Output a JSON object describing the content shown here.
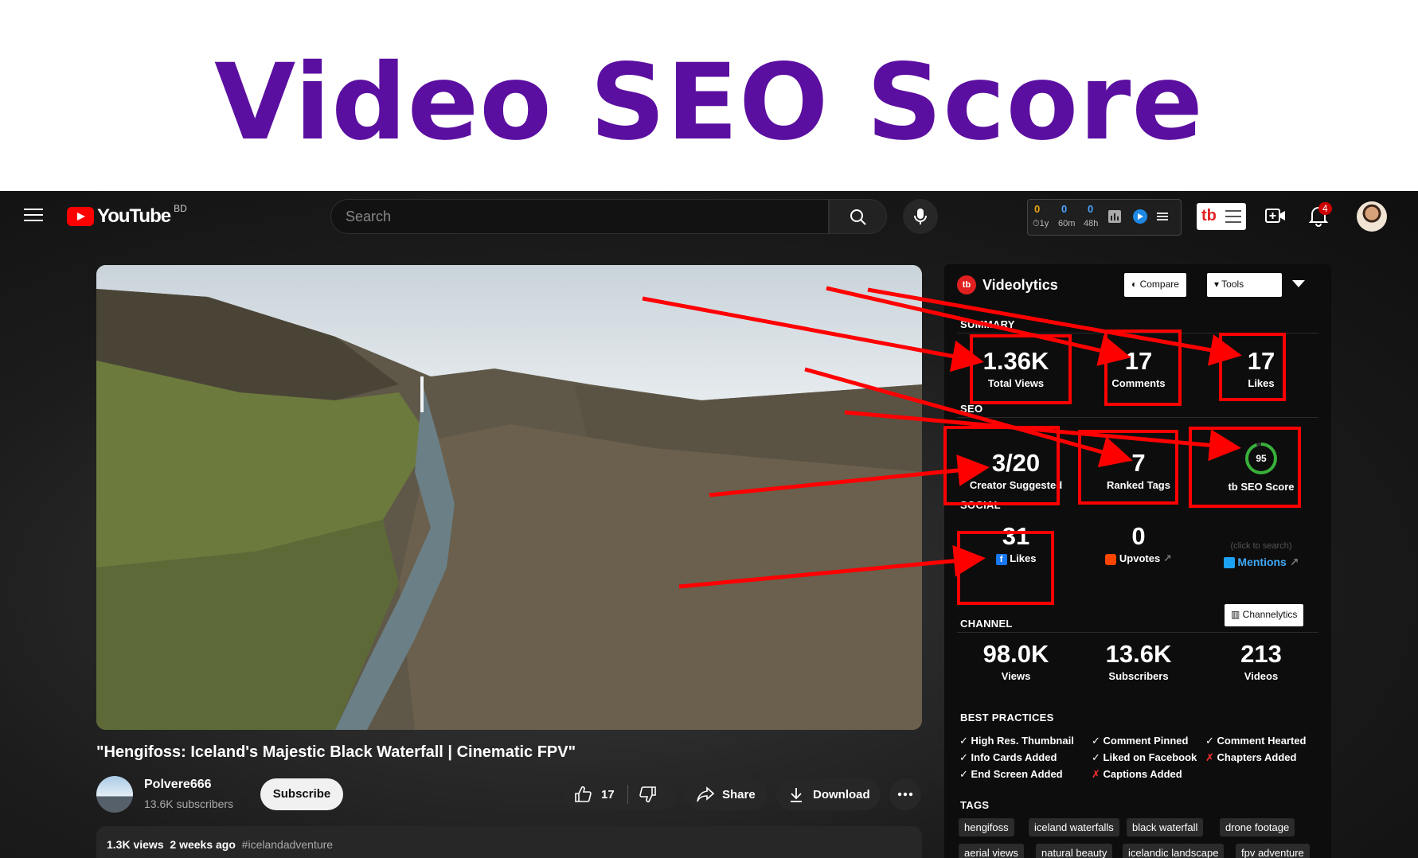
{
  "banner": {
    "title": "Video SEO Score"
  },
  "header": {
    "logo_text": "YouTube",
    "country": "BD",
    "search_placeholder": "Search",
    "ext_stats": [
      {
        "value": "0",
        "label": "1y",
        "color": "#e8a317"
      },
      {
        "value": "0",
        "label": "60m",
        "color": "#4aa3ff"
      },
      {
        "value": "0",
        "label": "48h",
        "color": "#4aa3ff"
      }
    ],
    "tb_logo": "tb",
    "notifications": "4"
  },
  "video": {
    "title": "\"Hengifoss: Iceland's Majestic Black Waterfall | Cinematic FPV\"",
    "channel": "Polvere666",
    "subscribers": "13.6K subscribers",
    "subscribe_label": "Subscribe",
    "likes": "17",
    "share_label": "Share",
    "download_label": "Download",
    "views": "1.3K views",
    "date": "2 weeks ago",
    "hashtag": "#icelandadventure"
  },
  "panel": {
    "title": "Videolytics",
    "logo": "tb",
    "compare_label": "Compare",
    "tools_label": "Tools",
    "summary_label": "SUMMARY",
    "summary": [
      {
        "value": "1.36K",
        "label": "Total Views"
      },
      {
        "value": "17",
        "label": "Comments"
      },
      {
        "value": "17",
        "label": "Likes"
      }
    ],
    "seo_label": "SEO",
    "seo": [
      {
        "value": "3/20",
        "label": "Creator Suggested"
      },
      {
        "value": "7",
        "label": "Ranked Tags"
      }
    ],
    "seo_score": {
      "value": "95",
      "label": "SEO Score",
      "fraction": 0.95
    },
    "social_label": "SOCIAL",
    "social": [
      {
        "value": "31",
        "label": "Likes"
      },
      {
        "value": "0",
        "label": "Upvotes"
      }
    ],
    "social_hint": "(click to search)",
    "mentions_label": "Mentions",
    "channelytics_label": "Channelytics",
    "channel_label": "CHANNEL",
    "channel": [
      {
        "value": "98.0K",
        "label": "Views"
      },
      {
        "value": "13.6K",
        "label": "Subscribers"
      },
      {
        "value": "213",
        "label": "Videos"
      }
    ],
    "best_practices_label": "BEST PRACTICES",
    "best_practices": [
      {
        "text": "High Res. Thumbnail",
        "ok": true
      },
      {
        "text": "Comment Pinned",
        "ok": true
      },
      {
        "text": "Comment Hearted",
        "ok": true
      },
      {
        "text": "Info Cards Added",
        "ok": true
      },
      {
        "text": "Liked on Facebook",
        "ok": true
      },
      {
        "text": "Chapters Added",
        "ok": false
      },
      {
        "text": "End Screen Added",
        "ok": true
      },
      {
        "text": "Captions Added",
        "ok": false
      }
    ],
    "tags_label": "TAGS",
    "tags": [
      "hengifoss",
      "iceland waterfalls",
      "black waterfall",
      "drone footage",
      "aerial views",
      "natural beauty",
      "icelandic landscape",
      "fpv adventure"
    ]
  },
  "colors": {
    "banner_title": "#5b0fa0",
    "highlight": "#ff0000",
    "youtube_red": "#ff0000",
    "score_ring": "#38b03a"
  }
}
